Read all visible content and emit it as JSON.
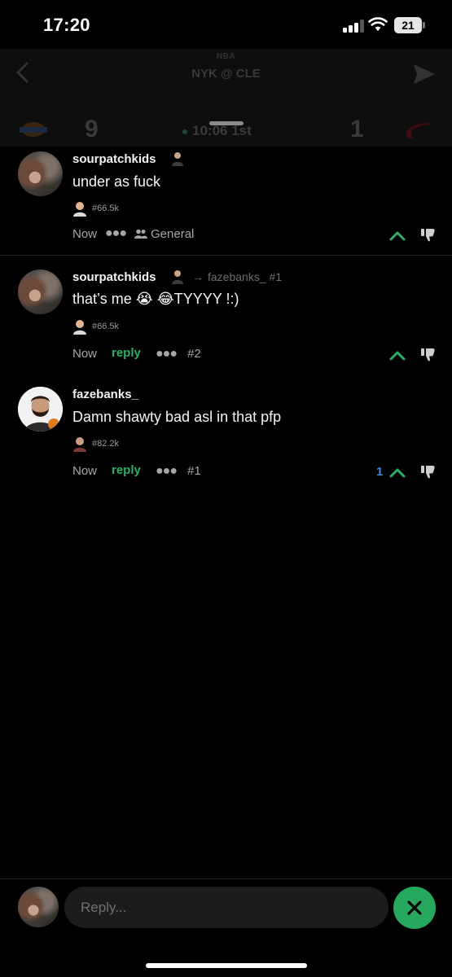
{
  "status_bar": {
    "time": "17:20",
    "battery": "21"
  },
  "header": {
    "league": "NBA",
    "matchup": "NYK @ CLE",
    "home_score": "9",
    "away_score": "1",
    "clock": "10:06 1st"
  },
  "comments": [
    {
      "username": "sourpatchkids",
      "text": "under as fuck",
      "rank": "#66.5k",
      "time": "Now",
      "channel": "General"
    },
    {
      "username": "sourpatchkids",
      "reply_to": "fazebanks_ #1",
      "text": "that’s me 😭 😂TYYYY !:)",
      "rank": "#66.5k",
      "time": "Now",
      "reply_label": "reply",
      "thread_number": "#2"
    },
    {
      "username": "fazebanks_",
      "text": "Damn shawty bad asl in that pfp",
      "rank": "#82.2k",
      "time": "Now",
      "reply_label": "reply",
      "thread_number": "#1",
      "upvotes": "1"
    }
  ],
  "composer": {
    "placeholder": "Reply..."
  },
  "colors": {
    "accent_green": "#27a85f",
    "upvote_blue": "#3b8be0",
    "background": "#000000"
  },
  "icons": [
    "back-icon",
    "send-icon",
    "upvote-icon",
    "downvote-icon",
    "more-dots-icon",
    "people-icon",
    "close-icon"
  ]
}
